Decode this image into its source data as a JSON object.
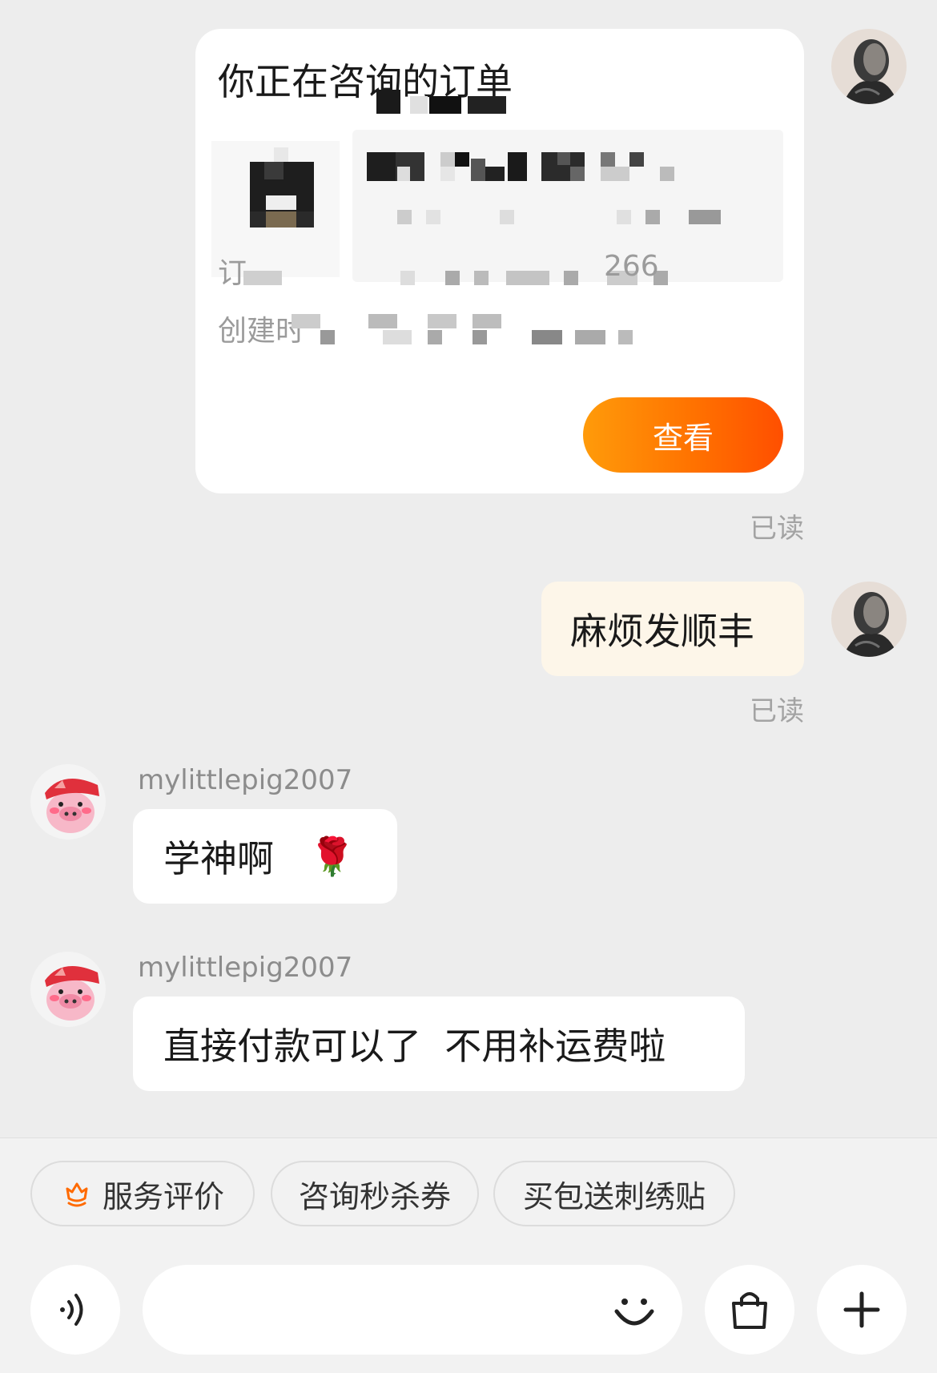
{
  "order_card": {
    "title": "你正在咨询的订单",
    "order_no_label": "订",
    "order_no_tail": "266",
    "created_label": "创建时",
    "view_button": "查看"
  },
  "messages": [
    {
      "side": "mine",
      "type": "card",
      "read": "已读"
    },
    {
      "side": "mine",
      "text": "麻烦发顺丰",
      "read": "已读"
    },
    {
      "side": "other",
      "sender": "mylittlepig2007",
      "text": "学神啊",
      "emoji": "🌹"
    },
    {
      "side": "other",
      "sender": "mylittlepig2007",
      "text": "直接付款可以了  不用补运费啦"
    }
  ],
  "quick_replies": [
    {
      "label": "服务评价",
      "icon": "flower-rating-icon",
      "icon_color": "#ff6a00"
    },
    {
      "label": "咨询秒杀券"
    },
    {
      "label": "买包送刺绣贴"
    }
  ],
  "composer": {
    "voice_icon": "voice-icon",
    "emoji_icon": "smiley-icon",
    "shop_icon": "shopping-bag-icon",
    "more_icon": "plus-icon",
    "input_value": ""
  },
  "colors": {
    "accent_start": "#ff9b0a",
    "accent_end": "#ff4f00",
    "mine_bubble": "#fdf6e9",
    "background": "#ededed"
  }
}
